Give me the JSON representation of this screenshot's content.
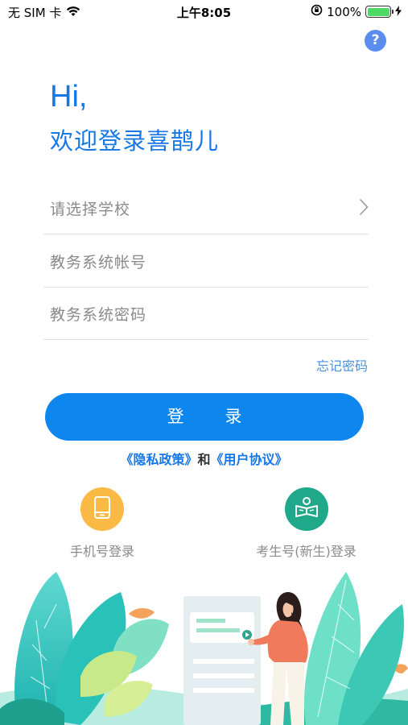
{
  "status_bar": {
    "carrier": "无 SIM 卡",
    "time": "上午8:05",
    "battery_percent_text": "100%",
    "battery_level": 1.0
  },
  "help_label": "?",
  "greeting": "Hi,",
  "welcome": "欢迎登录喜鹊儿",
  "form": {
    "school_placeholder": "请选择学校",
    "account_placeholder": "教务系统帐号",
    "password_placeholder": "教务系统密码"
  },
  "forgot_password": "忘记密码",
  "login_button": "登 录",
  "agreement": {
    "privacy": "《隐私政策》",
    "and": "和",
    "user_agreement": "《用户协议》"
  },
  "alt_logins": {
    "phone": {
      "label": "手机号登录",
      "icon": "phone-icon",
      "color": "#fbb946"
    },
    "exam": {
      "label": "考生号(新生)登录",
      "icon": "book-icon",
      "color": "#1fa98a"
    }
  },
  "colors": {
    "accent": "#1677e5",
    "button": "#0d86ee"
  }
}
